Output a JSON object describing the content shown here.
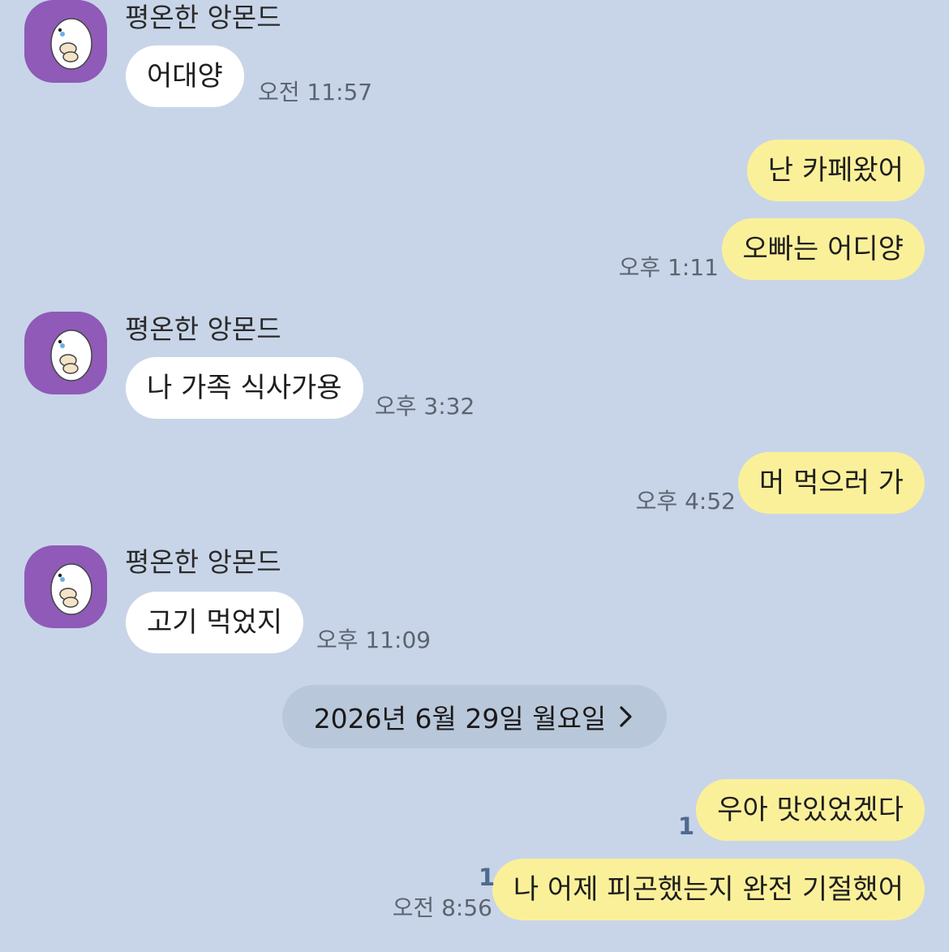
{
  "chat": {
    "partner_name": "평온한 앙몬드",
    "date_divider": "2026년 6월 29일 월요일",
    "messages": [
      {
        "side": "in",
        "text": "어대양",
        "time": "오전 11:57"
      },
      {
        "side": "out",
        "text": "난 카페왔어",
        "time": ""
      },
      {
        "side": "out",
        "text": "오빠는 어디양",
        "time": "오후 1:11"
      },
      {
        "side": "in",
        "text": "나 가족 식사가용",
        "time": "오후 3:32"
      },
      {
        "side": "out",
        "text": "머 먹으러 가",
        "time": "오후 4:52"
      },
      {
        "side": "in",
        "text": "고기 먹었지",
        "time": "오후 11:09"
      },
      {
        "side": "out",
        "text": "우아 맛있었겠다",
        "unread": "1",
        "time": ""
      },
      {
        "side": "out",
        "text": "나 어제 피곤했는지 완전 기절했어",
        "unread": "1",
        "time": "오전 8:56"
      }
    ]
  },
  "colors": {
    "background": "#c8d5e8",
    "incoming_bubble": "#ffffff",
    "outgoing_bubble": "#fbf09a",
    "avatar_bg": "#8f5ab8",
    "unread_count": "#4e6a8f"
  }
}
